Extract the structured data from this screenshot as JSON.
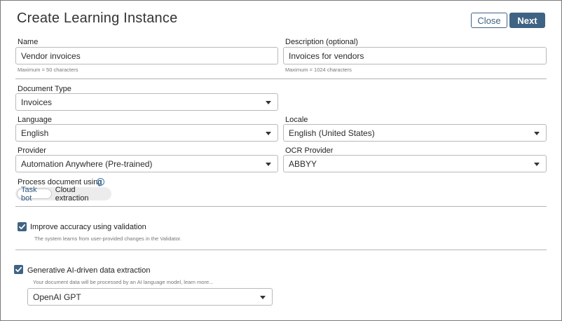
{
  "dialog": {
    "title": "Create Learning Instance",
    "close_label": "Close",
    "next_label": "Next"
  },
  "name": {
    "label": "Name",
    "value": "Vendor invoices",
    "hint": "Maximum = 50 characters"
  },
  "description": {
    "label": "Description (optional)",
    "value": "Invoices for vendors",
    "hint": "Maximum = 1024 characters"
  },
  "document_type": {
    "label": "Document Type",
    "value": "Invoices"
  },
  "language": {
    "label": "Language",
    "value": "English"
  },
  "locale": {
    "label": "Locale",
    "value": "English (United States)"
  },
  "provider": {
    "label": "Provider",
    "value": "Automation Anywhere (Pre-trained)"
  },
  "ocr_provider": {
    "label": "OCR Provider",
    "value": "ABBYY"
  },
  "process": {
    "label": "Process document using",
    "options": [
      "Task bot",
      "Cloud extraction"
    ],
    "selected": "Task bot"
  },
  "validation": {
    "checked": true,
    "label": "Improve accuracy using validation",
    "description": "The system learns from user-provided changes in the Validator."
  },
  "gen_ai": {
    "checked": true,
    "label": "Generative AI-driven data extraction",
    "description": "Your document data will be processed by an AI language model, learn more...",
    "model": "OpenAI GPT"
  },
  "colors": {
    "accent": "#3f6384",
    "info_icon": "#3b79b8",
    "field_border": "#b9b9b9"
  }
}
